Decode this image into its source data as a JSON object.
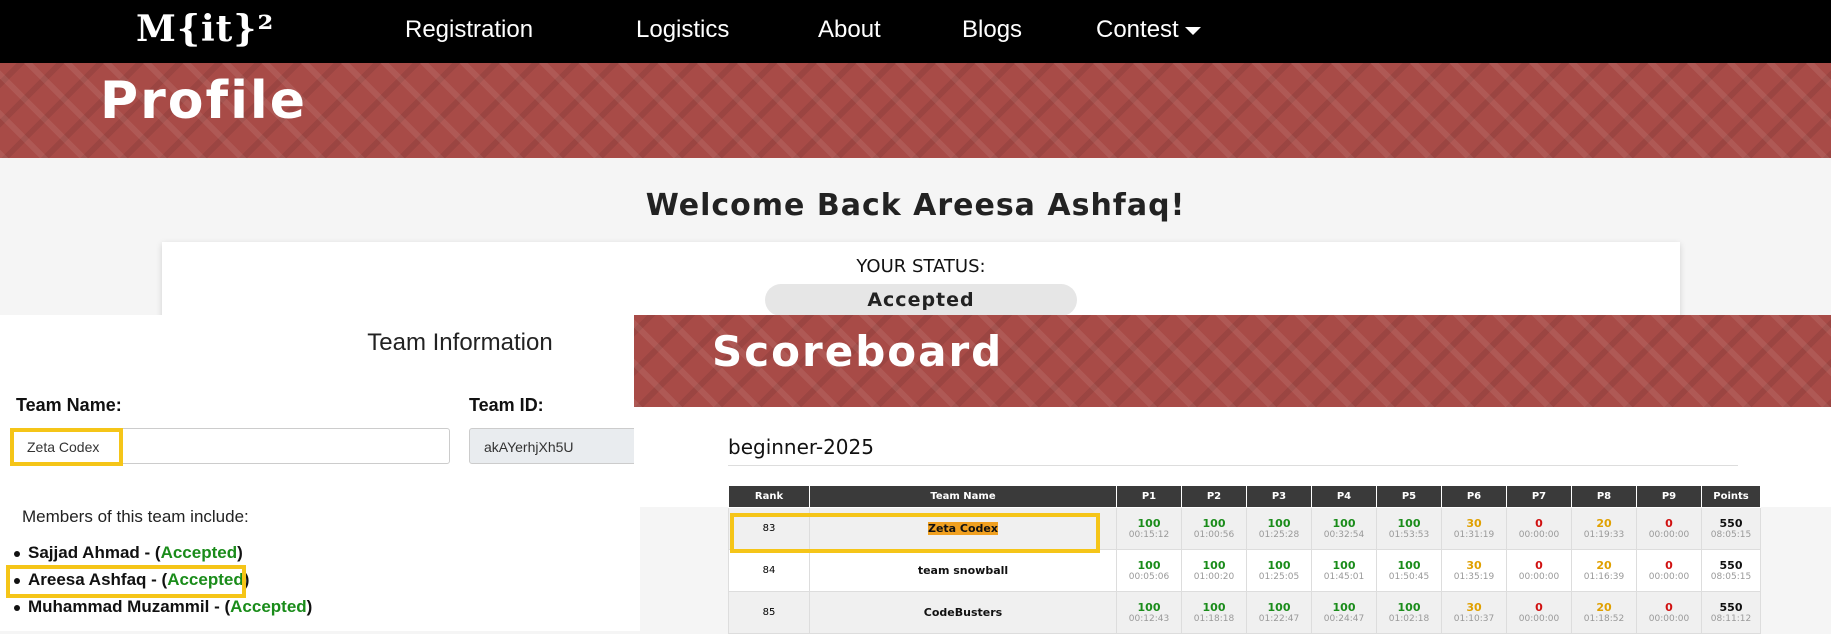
{
  "nav": {
    "logo": "M{it}²",
    "items": [
      "Registration",
      "Logistics",
      "About",
      "Blogs",
      "Contest"
    ]
  },
  "profile": {
    "banner_title": "Profile",
    "welcome": "Welcome Back Areesa Ashfaq!",
    "status_label": "YOUR STATUS:",
    "status_value": "Accepted"
  },
  "team": {
    "title": "Team Information",
    "name_label": "Team Name:",
    "name_value": "Zeta Codex",
    "id_label": "Team ID:",
    "id_value": "akAYerhjXh5U",
    "members_intro": "Members of this team include:",
    "members": [
      {
        "name": "Sajjad Ahmad",
        "status": "Accepted"
      },
      {
        "name": "Areesa Ashfaq",
        "status": "Accepted"
      },
      {
        "name": "Muhammad Muzammil",
        "status": "Accepted"
      }
    ]
  },
  "scoreboard": {
    "banner_title": "Scoreboard",
    "contest": "beginner-2025",
    "headers": [
      "Rank",
      "Team Name",
      "P1",
      "P2",
      "P3",
      "P4",
      "P5",
      "P6",
      "P7",
      "P8",
      "P9",
      "Points"
    ],
    "rows": [
      {
        "rank": "83",
        "team": "Zeta Codex",
        "scores": [
          "100",
          "100",
          "100",
          "100",
          "100",
          "30",
          "0",
          "20",
          "0"
        ],
        "times": [
          "00:15:12",
          "01:00:56",
          "01:25:28",
          "00:32:54",
          "01:53:53",
          "01:31:19",
          "00:00:00",
          "01:19:33",
          "00:00:00"
        ],
        "points": "550",
        "total_time": "08:05:15"
      },
      {
        "rank": "84",
        "team": "team snowball",
        "scores": [
          "100",
          "100",
          "100",
          "100",
          "100",
          "30",
          "0",
          "20",
          "0"
        ],
        "times": [
          "00:05:06",
          "01:00:20",
          "01:25:05",
          "01:45:01",
          "01:50:45",
          "01:35:19",
          "00:00:00",
          "01:16:39",
          "00:00:00"
        ],
        "points": "550",
        "total_time": "08:05:15"
      },
      {
        "rank": "85",
        "team": "CodeBusters",
        "scores": [
          "100",
          "100",
          "100",
          "100",
          "100",
          "30",
          "0",
          "20",
          "0"
        ],
        "times": [
          "00:12:43",
          "01:18:18",
          "01:22:47",
          "00:24:47",
          "01:02:18",
          "01:10:37",
          "00:00:00",
          "01:18:52",
          "00:00:00"
        ],
        "points": "550",
        "total_time": "08:11:12"
      }
    ]
  },
  "colors": {
    "banner": "#a84b47",
    "highlight": "#f5c518",
    "accepted": "#1a8c1a",
    "partial": "#e0a000",
    "zero": "#d01010"
  }
}
